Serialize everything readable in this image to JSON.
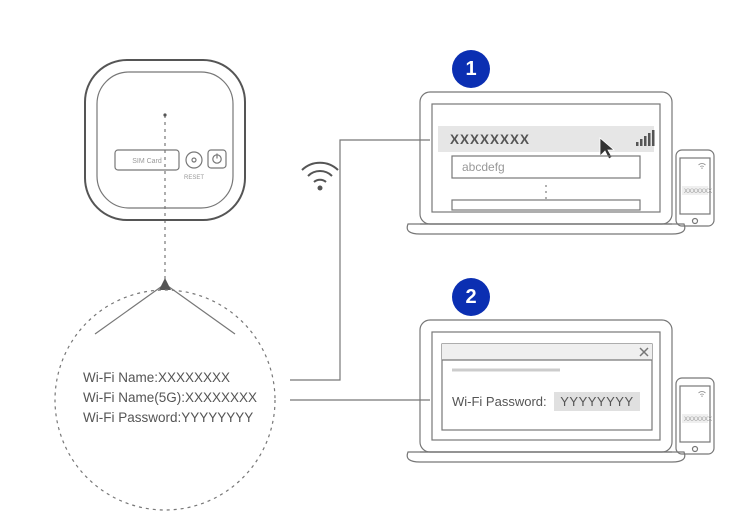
{
  "device": {
    "sim_label": "SIM Card",
    "reset_label": "RESET"
  },
  "label_panel": {
    "line1_key": "Wi-Fi Name:",
    "line1_val": "XXXXXXXX",
    "line2_key": "Wi-Fi Name(5G):",
    "line2_val": "XXXXXXXX",
    "line3_key": "Wi-Fi Password:",
    "line3_val": "YYYYYYYY"
  },
  "step1": {
    "number": "1",
    "selected_ssid": "XXXXXXXX",
    "other_ssid": "abcdefg",
    "signal_icon": "signal-bars-icon",
    "cursor_icon": "cursor-icon",
    "phone_text": "XXXXXXX"
  },
  "step2": {
    "number": "2",
    "prompt_label": "Wi-Fi Password:",
    "prompt_value": "YYYYYYYY",
    "phone_text": "XXXXXXX"
  },
  "icons": {
    "wifi": "wifi-icon",
    "power": "power-icon"
  },
  "colors": {
    "badge": "#0b2fb2",
    "line": "#777",
    "highlight": "#e0e0e0"
  }
}
